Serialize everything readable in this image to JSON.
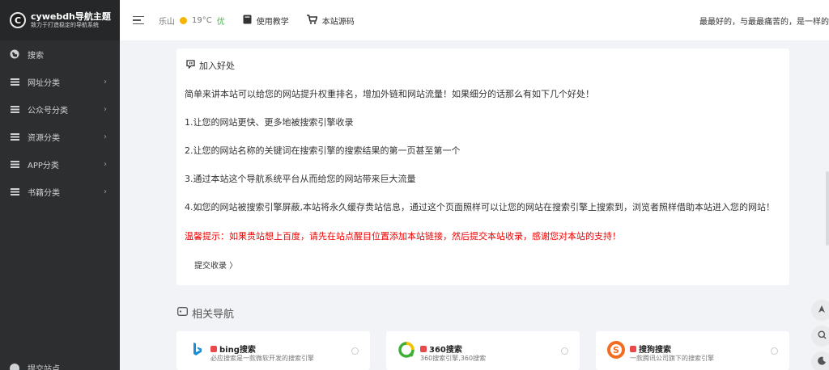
{
  "brand": {
    "logo_letter": "C",
    "title": "cywebdh导航主题",
    "subtitle": "致力于打造稳定的导航系统"
  },
  "sidebar": {
    "items": [
      {
        "label": "搜索",
        "icon": "search-globe-icon"
      },
      {
        "label": "网址分类",
        "icon": "menu-bars-icon"
      },
      {
        "label": "公众号分类",
        "icon": "menu-bars-icon"
      },
      {
        "label": "资源分类",
        "icon": "menu-bars-icon"
      },
      {
        "label": "APP分类",
        "icon": "menu-bars-icon"
      },
      {
        "label": "书籍分类",
        "icon": "menu-bars-icon"
      }
    ],
    "bottom_label": "提交站点"
  },
  "header": {
    "city": "乐山",
    "temp": "19°C",
    "air": "优",
    "links": [
      "使用教学",
      "本站源码"
    ],
    "marquee": "最最好的，与最最痛苦的，是一样的"
  },
  "card": {
    "title": "加入好处",
    "intro": "简单来讲本站可以给您的网站提升权重排名，增加外链和网站流量！如果细分的话那么有如下几个好处！",
    "points": [
      "1.让您的网站更快、更多地被搜索引擎收录",
      "2.让您的网站名称的关键词在搜索引擎的搜索结果的第一页甚至第一个",
      "3.通过本站这个导航系统平台从而给您的网站带来巨大流量",
      "4.如您的网站被搜索引擎屏蔽,本站将永久缓存贵站信息，通过这个页面照样可以让您的网站在搜索引擎上搜索到，浏览者照样借助本站进入您的网站！"
    ],
    "warning": "温馨提示：如果贵站想上百度，请先在站点醒目位置添加本站链接，然后提交本站收录，感谢您对本站的支持！",
    "submit_label": "提交收录 〉"
  },
  "related": {
    "title": "相关导航",
    "sites": [
      {
        "name": "bing搜索",
        "desc": "必应搜索是一款微软开发的搜索引擎"
      },
      {
        "name": "360搜索",
        "desc": "360搜索引擎,360搜索"
      },
      {
        "name": "搜狗搜索",
        "desc": "一款腾讯公司旗下的搜索引擎"
      }
    ]
  },
  "colors": {
    "sidebar": "#2c2e2f",
    "warning": "#ee0000",
    "air_quality": "#4caf50"
  }
}
